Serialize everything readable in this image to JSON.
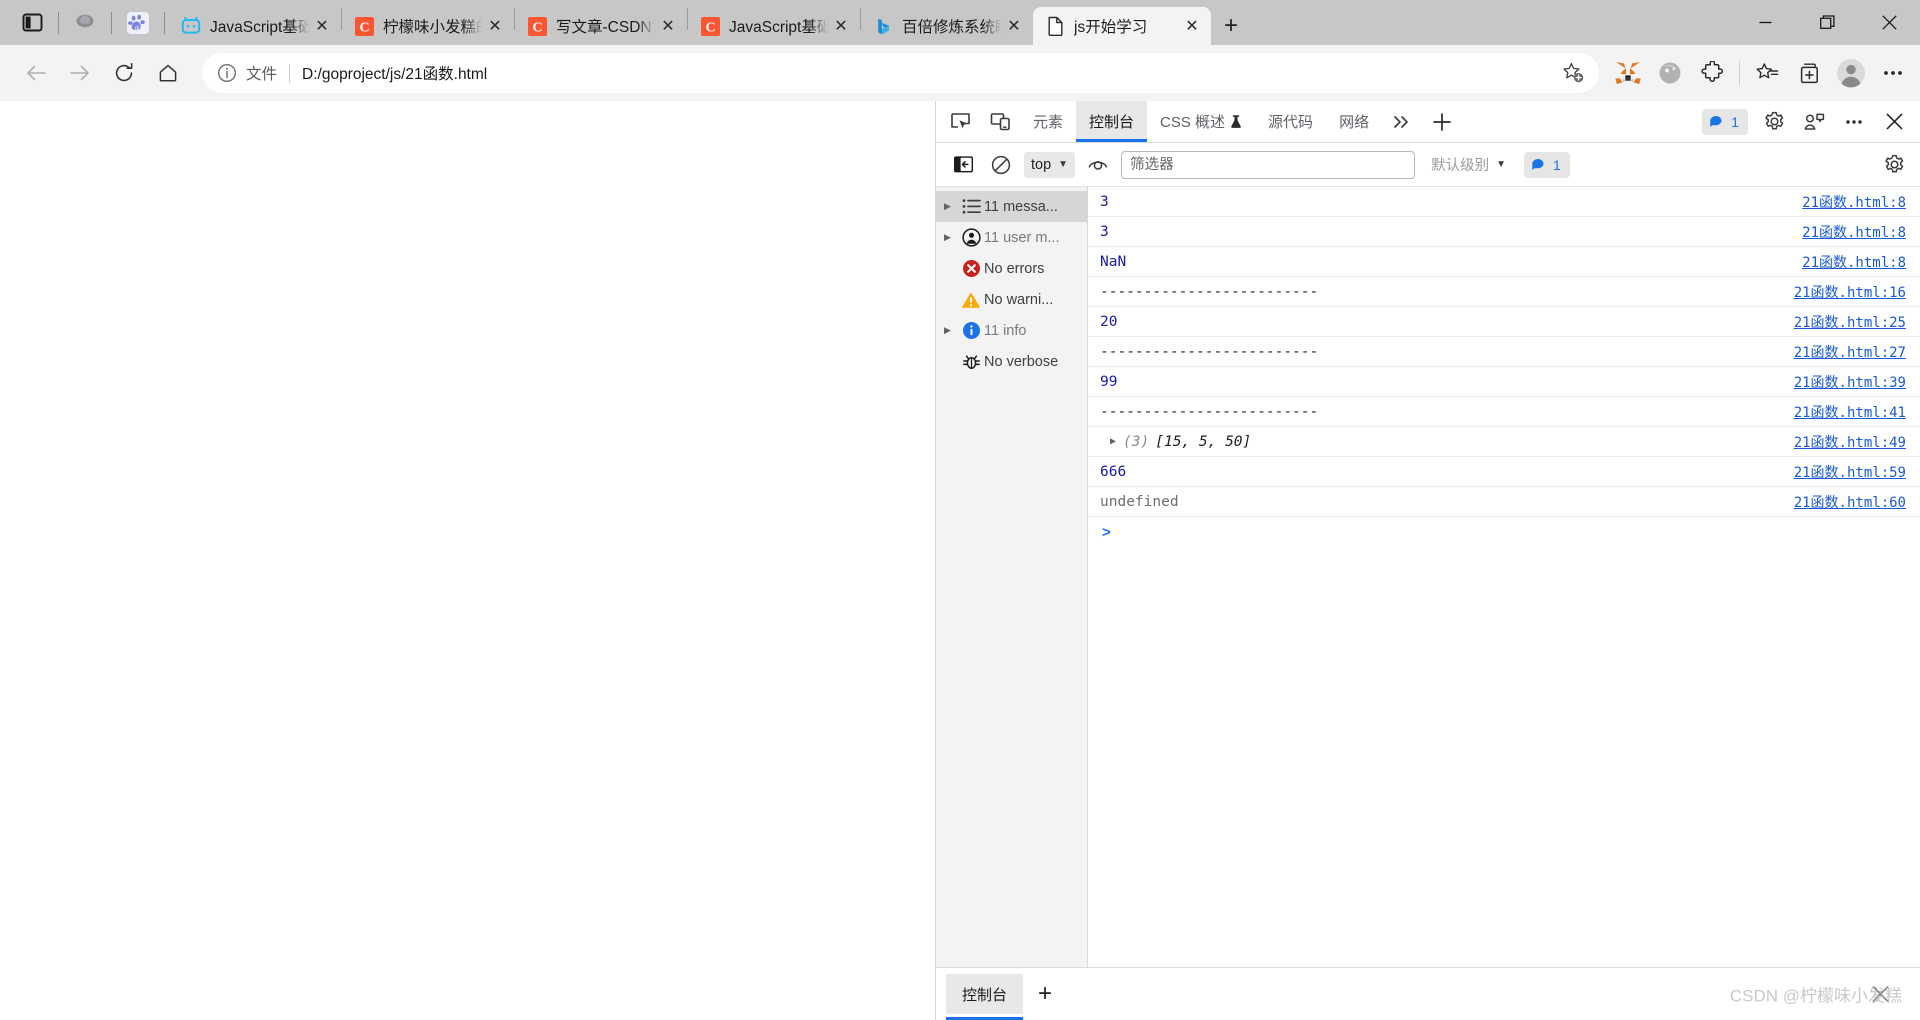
{
  "browser": {
    "left_icons": [
      {
        "name": "tab-actions-icon",
        "glyph": "panel"
      },
      {
        "name": "workspaces-icon",
        "glyph": "orb"
      },
      {
        "name": "baidu-shortcut-icon",
        "glyph": "baidu"
      }
    ],
    "tabs": [
      {
        "title": "JavaScript基础语",
        "favicon": "bilibili",
        "active": false
      },
      {
        "title": "柠檬味小发糕的",
        "favicon": "csdn",
        "active": false
      },
      {
        "title": "写文章-CSDN博客",
        "favicon": "csdn",
        "active": false
      },
      {
        "title": "JavaScript基础学",
        "favicon": "csdn",
        "active": false
      },
      {
        "title": "百倍修炼系统瞬",
        "favicon": "bing",
        "active": false
      },
      {
        "title": "js开始学习",
        "favicon": "file",
        "active": true
      }
    ],
    "new_tab_label": "+",
    "window_controls": {
      "minimize": "minimize-button",
      "maximize": "maximize-button",
      "close": "close-button"
    },
    "nav": {
      "back": "back-button",
      "forward": "forward-button",
      "reload": "reload-button",
      "home": "home-button"
    },
    "omnibox": {
      "scheme_label": "文件",
      "url": "D:/goproject/js/21函数.html",
      "favorite_label": "add-favorite"
    },
    "toolbar_icons": [
      {
        "name": "metamask-extension-icon"
      },
      {
        "name": "extension-grayscale-icon"
      },
      {
        "name": "extensions-puzzle-icon"
      },
      {
        "name": "favorites-icon"
      },
      {
        "name": "collections-icon"
      },
      {
        "name": "profile-avatar-icon"
      },
      {
        "name": "settings-and-more-icon"
      }
    ]
  },
  "devtools": {
    "tabs": [
      {
        "label": "元素",
        "active": false
      },
      {
        "label": "控制台",
        "active": true
      },
      {
        "label": "CSS 概述",
        "active": false,
        "flask": true
      },
      {
        "label": "源代码",
        "active": false
      },
      {
        "label": "网络",
        "active": false
      }
    ],
    "more_tabs_label": "»",
    "add_tab_label": "+",
    "issues_count": "1",
    "right_icons": [
      {
        "name": "settings-gear-icon"
      },
      {
        "name": "customize-devtools-icon"
      },
      {
        "name": "more-options-icon"
      },
      {
        "name": "close-devtools-icon"
      }
    ],
    "filterbar": {
      "sidebar_toggle": "console-sidebar-toggle",
      "clear_label": "clear-console",
      "context": "top",
      "live_expression_label": "create-live-expression",
      "filter_placeholder": "筛选器",
      "filter_value": "",
      "level": "默认级别",
      "issues_count": "1",
      "settings_label": "console-settings"
    },
    "sidebar": [
      {
        "label": "11 messa...",
        "icon": "list-icon",
        "selected": true,
        "expandable": true,
        "muted": false
      },
      {
        "label": "11 user m...",
        "icon": "user-message-icon",
        "selected": false,
        "expandable": true,
        "muted": true
      },
      {
        "label": "No errors",
        "icon": "error-icon",
        "selected": false,
        "expandable": false,
        "muted": false
      },
      {
        "label": "No warni...",
        "icon": "warning-icon",
        "selected": false,
        "expandable": false,
        "muted": false
      },
      {
        "label": "11 info",
        "icon": "info-icon",
        "selected": false,
        "expandable": true,
        "muted": true
      },
      {
        "label": "No verbose",
        "icon": "verbose-bug-icon",
        "selected": false,
        "expandable": false,
        "muted": false
      }
    ],
    "log_rows": [
      {
        "message": "3",
        "kind": "number",
        "source": "21函数.html:8"
      },
      {
        "message": "3",
        "kind": "number",
        "source": "21函数.html:8"
      },
      {
        "message": "NaN",
        "kind": "number",
        "source": "21函数.html:8"
      },
      {
        "message": "-------------------------",
        "kind": "text",
        "source": "21函数.html:16"
      },
      {
        "message": "20",
        "kind": "number",
        "source": "21函数.html:25"
      },
      {
        "message": "-------------------------",
        "kind": "text",
        "source": "21函数.html:27"
      },
      {
        "message": "99",
        "kind": "number",
        "source": "21函数.html:39"
      },
      {
        "message": "-------------------------",
        "kind": "text",
        "source": "21函数.html:41"
      },
      {
        "message": "[15, 5, 50]",
        "kind": "array",
        "count": "(3)",
        "source": "21函数.html:49"
      },
      {
        "message": "666",
        "kind": "number",
        "source": "21函数.html:59"
      },
      {
        "message": "undefined",
        "kind": "undefined",
        "source": "21函数.html:60"
      }
    ],
    "prompt": ">",
    "drawer": {
      "tab_label": "控制台",
      "add_label": "+"
    }
  },
  "watermark": "CSDN @柠檬味小发糕",
  "colors": {
    "accent": "#1a73e8",
    "tabstrip_bg": "#c7c7c7",
    "toolbar_bg": "#f3f3f3",
    "console_number": "#1a1aa6",
    "source_link": "#1a5ad7",
    "error_red": "#c5221f",
    "warning_amber": "#f9ab00",
    "info_blue": "#1a73e8"
  }
}
